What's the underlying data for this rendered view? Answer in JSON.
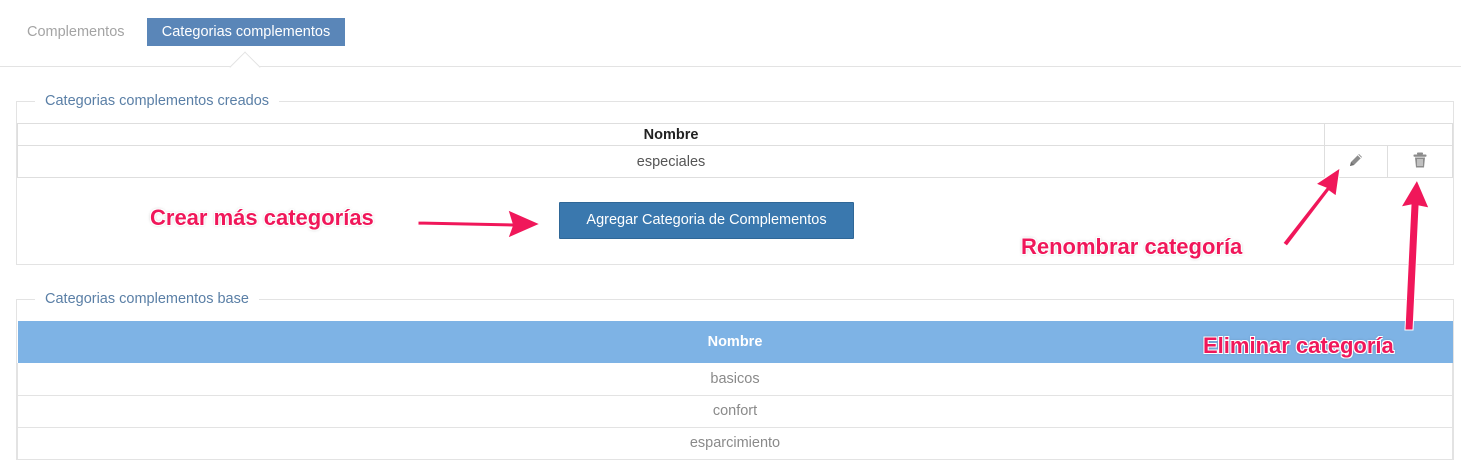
{
  "tabs": [
    {
      "label": "Complementos",
      "active": false
    },
    {
      "label": "Categorias complementos",
      "active": true
    }
  ],
  "created_panel": {
    "legend": "Categorias complementos creados",
    "column_header": "Nombre",
    "rows": [
      {
        "name": "especiales",
        "edit_icon": "pencil-icon",
        "delete_icon": "trash-icon"
      }
    ],
    "add_button_label": "Agregar Categoria de Complementos"
  },
  "base_panel": {
    "legend": "Categorias complementos base",
    "column_header": "Nombre",
    "rows": [
      "basicos",
      "confort",
      "esparcimiento"
    ]
  },
  "annotations": {
    "create": "Crear más categorías",
    "rename": "Renombrar categoría",
    "delete": "Eliminar categoría"
  },
  "colors": {
    "active_tab": "#5a86b8",
    "primary_button": "#3a78ae",
    "base_header": "#7eb3e5",
    "annotation": "#f0175a"
  }
}
